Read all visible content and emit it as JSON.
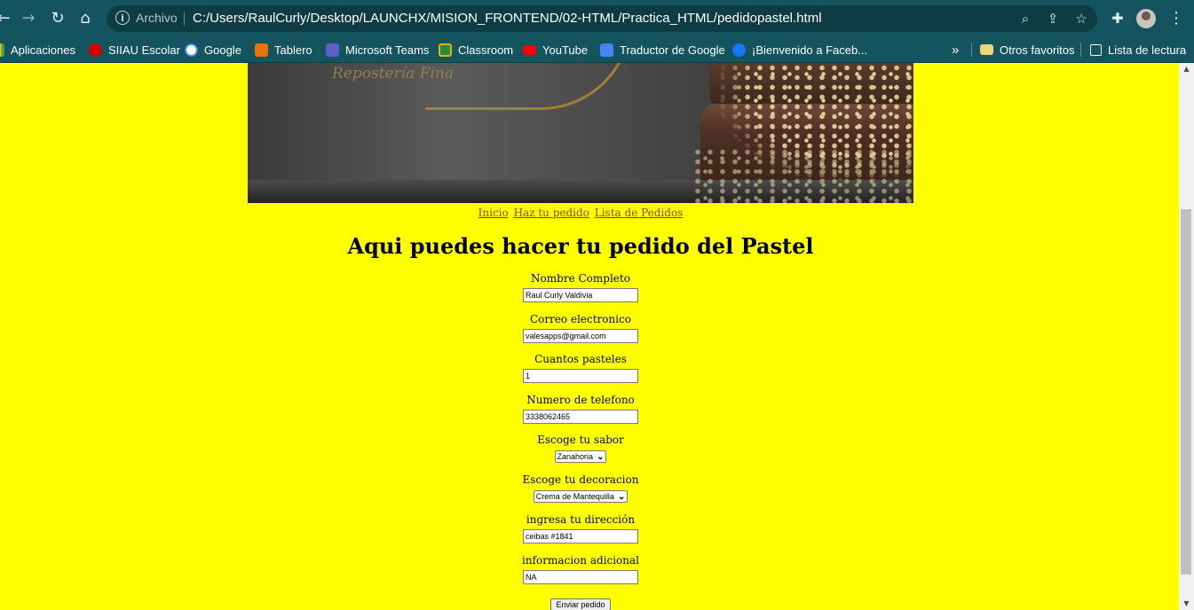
{
  "browser": {
    "back": "←",
    "forward": "→",
    "reload": "↻",
    "home": "⌂",
    "security_label": "Archivo",
    "url": "C:/Users/RaulCurly/Desktop/LAUNCHX/MISION_FRONTEND/02-HTML/Practica_HTML/pedidopastel.html",
    "zoom": "⌕",
    "share": "⇪",
    "star": "☆",
    "extensions": "✚",
    "menu": "⋮"
  },
  "bookmarks": {
    "items": [
      {
        "label": "Aplicaciones",
        "color": "#ea4335"
      },
      {
        "label": "SIIAU Escolar",
        "color": "#d40000"
      },
      {
        "label": "Google",
        "color": "#ffffff"
      },
      {
        "label": "Tablero",
        "color": "#e8710a"
      },
      {
        "label": "Microsoft Teams",
        "color": "#5b5fc7"
      },
      {
        "label": "Classroom",
        "color": "#f9ab00"
      },
      {
        "label": "YouTube",
        "color": "#ff0000"
      },
      {
        "label": "Traductor de Google",
        "color": "#4285f4"
      },
      {
        "label": "¡Bienvenido a Faceb...",
        "color": "#1877f2"
      }
    ],
    "overflow": "»",
    "other": "Otros favoritos",
    "reading_list": "Lista de lectura"
  },
  "page": {
    "banner_logo": "Repostería Fina",
    "nav": {
      "inicio": "Inicio",
      "pedido": "Haz tu pedido",
      "lista": "Lista de Pedidos"
    },
    "heading": "Aqui puedes hacer tu pedido del Pastel",
    "form": {
      "nombre_label": "Nombre Completo",
      "nombre_value": "Raul Curly Valdivia",
      "correo_label": "Correo electronico",
      "correo_value": "valesapps@gmail.com",
      "cantidad_label": "Cuantos pasteles",
      "cantidad_value": "1",
      "telefono_label": "Numero de telefono",
      "telefono_value": "3338062465",
      "sabor_label": "Escoge tu sabor",
      "sabor_value": "Zanahoria",
      "decoracion_label": "Escoge tu decoracion",
      "decoracion_value": "Crema de Mantequilla",
      "direccion_label": "ingresa tu dirección",
      "direccion_value": "ceibas #1841",
      "info_label": "informacion adicional",
      "info_value": "NA",
      "submit_label": "Enviar pedido"
    }
  }
}
